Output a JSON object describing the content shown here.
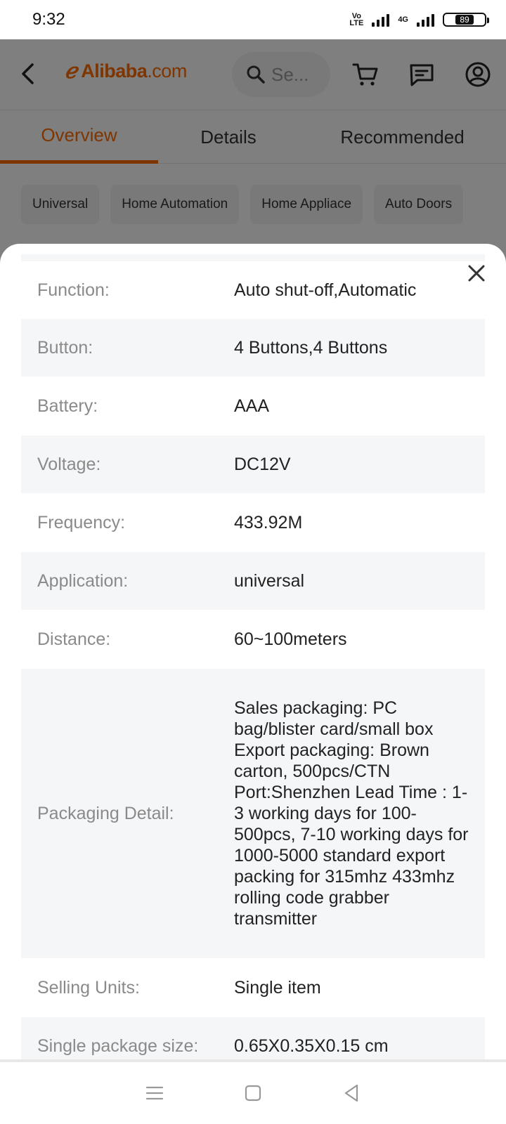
{
  "status_bar": {
    "time": "9:32",
    "volte_top": "Vo",
    "volte_bottom": "LTE",
    "network": "4G",
    "battery": "89"
  },
  "header": {
    "brand": "Alibaba",
    "brand_suffix": ".com",
    "search_placeholder": "Se...",
    "icons": [
      "back-arrow-icon",
      "search-icon",
      "cart-icon",
      "message-icon",
      "account-icon"
    ]
  },
  "tabs": [
    {
      "label": "Overview",
      "active": true
    },
    {
      "label": "Details",
      "active": false
    },
    {
      "label": "Recommended",
      "active": false
    }
  ],
  "chips": [
    "Universal",
    "Home Automation",
    "Home Appliace",
    "Auto Doors"
  ],
  "specs": [
    {
      "label": "Function:",
      "value": "Auto shut-off,Automatic"
    },
    {
      "label": "Button:",
      "value": "4 Buttons,4 Buttons"
    },
    {
      "label": "Battery:",
      "value": "AAA"
    },
    {
      "label": "Voltage:",
      "value": "DC12V"
    },
    {
      "label": "Frequency:",
      "value": "433.92M"
    },
    {
      "label": "Application:",
      "value": "universal"
    },
    {
      "label": "Distance:",
      "value": "60~100meters"
    },
    {
      "label": "Packaging Detail:",
      "value": "Sales packaging: PC bag/blister card/small box Export packaging: Brown carton, 500pcs/CTN Port:Shenzhen Lead Time : 1-3 working days for 100-500pcs, 7-10 working days for 1000-5000 standard export packing for 315mhz 433mhz rolling code grabber transmitter"
    },
    {
      "label": "Selling Units:",
      "value": "Single item"
    },
    {
      "label": "Single package size:",
      "value": "0.65X0.35X0.15 cm"
    }
  ],
  "colors": {
    "accent": "#ff6a00",
    "shaded_row": "#f5f6f8",
    "label_text": "#8a8a8a",
    "value_text": "#222222"
  },
  "nav_bar": [
    "menu-icon",
    "home-square-icon",
    "back-triangle-icon"
  ]
}
